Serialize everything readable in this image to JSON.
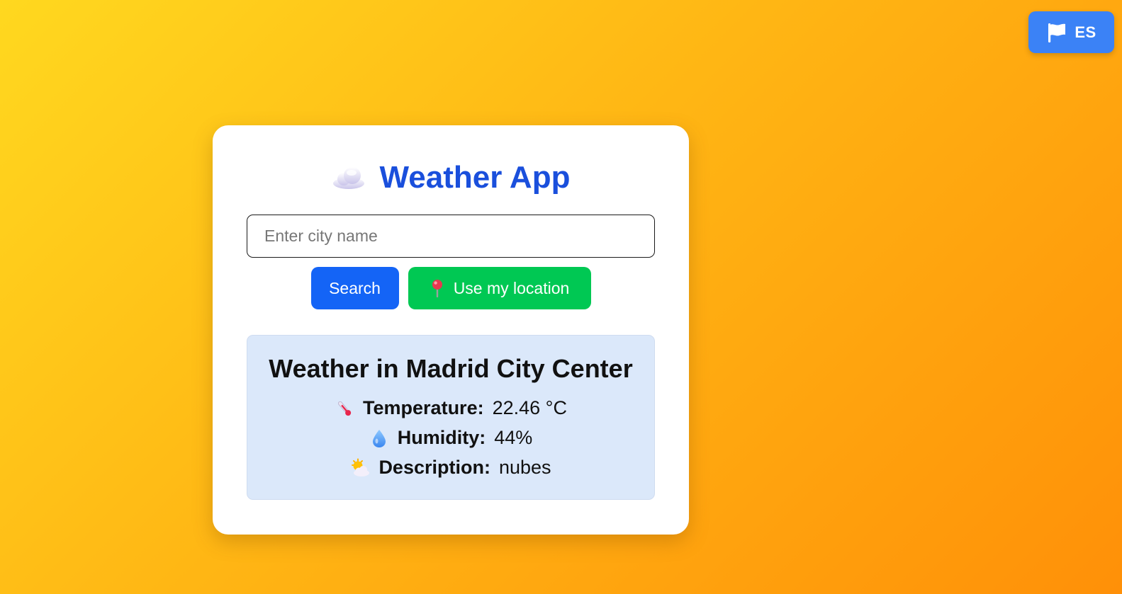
{
  "language_toggle": {
    "label": "ES",
    "icon": "flag-icon"
  },
  "header": {
    "icon": "cloud-icon",
    "title": "Weather App"
  },
  "search": {
    "placeholder": "Enter city name",
    "value": ""
  },
  "buttons": {
    "search_label": "Search",
    "location_icon": "pin-icon",
    "location_label": "Use my location"
  },
  "weather": {
    "title": "Weather in Madrid City Center",
    "temperature": {
      "icon": "thermometer-icon",
      "label": "Temperature:",
      "value": "22.46 °C"
    },
    "humidity": {
      "icon": "droplet-icon",
      "label": "Humidity:",
      "value": "44%"
    },
    "description": {
      "icon": "sun-behind-cloud-icon",
      "label": "Description:",
      "value": "nubes"
    }
  },
  "colors": {
    "background_start": "#ffd81f",
    "background_end": "#ff9008",
    "title": "#1a4fdc",
    "search_button": "#1464f6",
    "location_button": "#00c853",
    "language_button": "#3b82f6",
    "result_panel": "#dbe8fa"
  }
}
